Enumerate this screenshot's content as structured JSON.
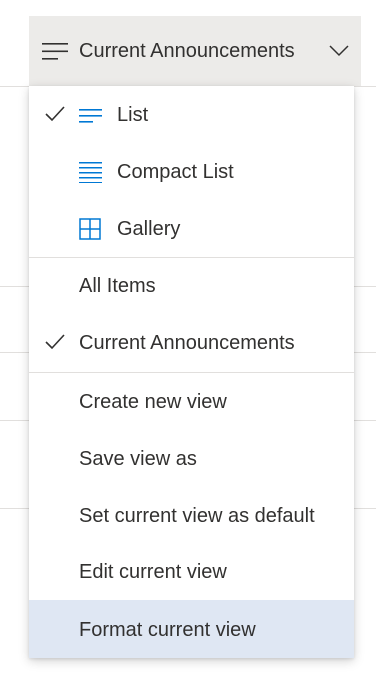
{
  "view_switcher": {
    "icon": "lines-icon",
    "label": "Current Announcements",
    "chevron": "chevron-down-icon"
  },
  "menu": {
    "layout_options": [
      {
        "label": "List",
        "icon": "list-icon",
        "checked": true
      },
      {
        "label": "Compact List",
        "icon": "compact-list-icon",
        "checked": false
      },
      {
        "label": "Gallery",
        "icon": "gallery-icon",
        "checked": false
      }
    ],
    "views": [
      {
        "label": "All Items",
        "checked": false
      },
      {
        "label": "Current Announcements",
        "checked": true
      }
    ],
    "actions": [
      {
        "label": "Create new view"
      },
      {
        "label": "Save view as"
      },
      {
        "label": "Set current view as default"
      },
      {
        "label": "Edit current view"
      },
      {
        "label": "Format current view",
        "highlighted": true
      }
    ]
  },
  "colors": {
    "accent": "#0078d4",
    "highlight": "#dfe7f3",
    "button_bg": "#ecebe9",
    "text": "#323130"
  }
}
